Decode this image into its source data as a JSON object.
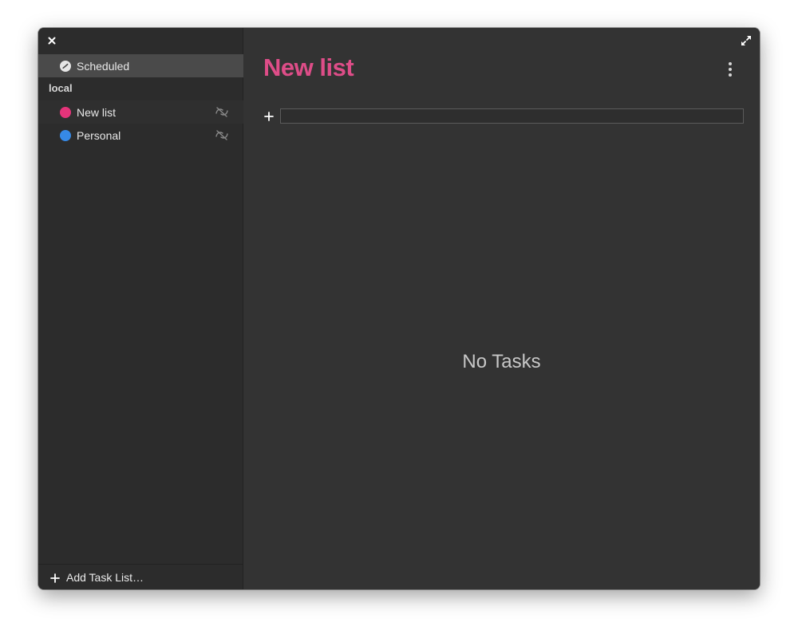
{
  "sidebar": {
    "scheduled_label": "Scheduled",
    "section_label": "local",
    "lists": [
      {
        "label": "New list",
        "color": "#e5347a"
      },
      {
        "label": "Personal",
        "color": "#3689e6"
      }
    ],
    "add_list_label": "Add Task List…"
  },
  "main": {
    "title": "New list",
    "title_color": "#de4d88",
    "new_task_value": "",
    "empty_state": "No Tasks"
  },
  "icons": {
    "close": "close-icon",
    "maximize": "maximize-icon",
    "scheduled": "clock-icon",
    "sync": "sync-disabled-icon",
    "menu": "more-vertical-icon",
    "add": "plus-icon"
  }
}
